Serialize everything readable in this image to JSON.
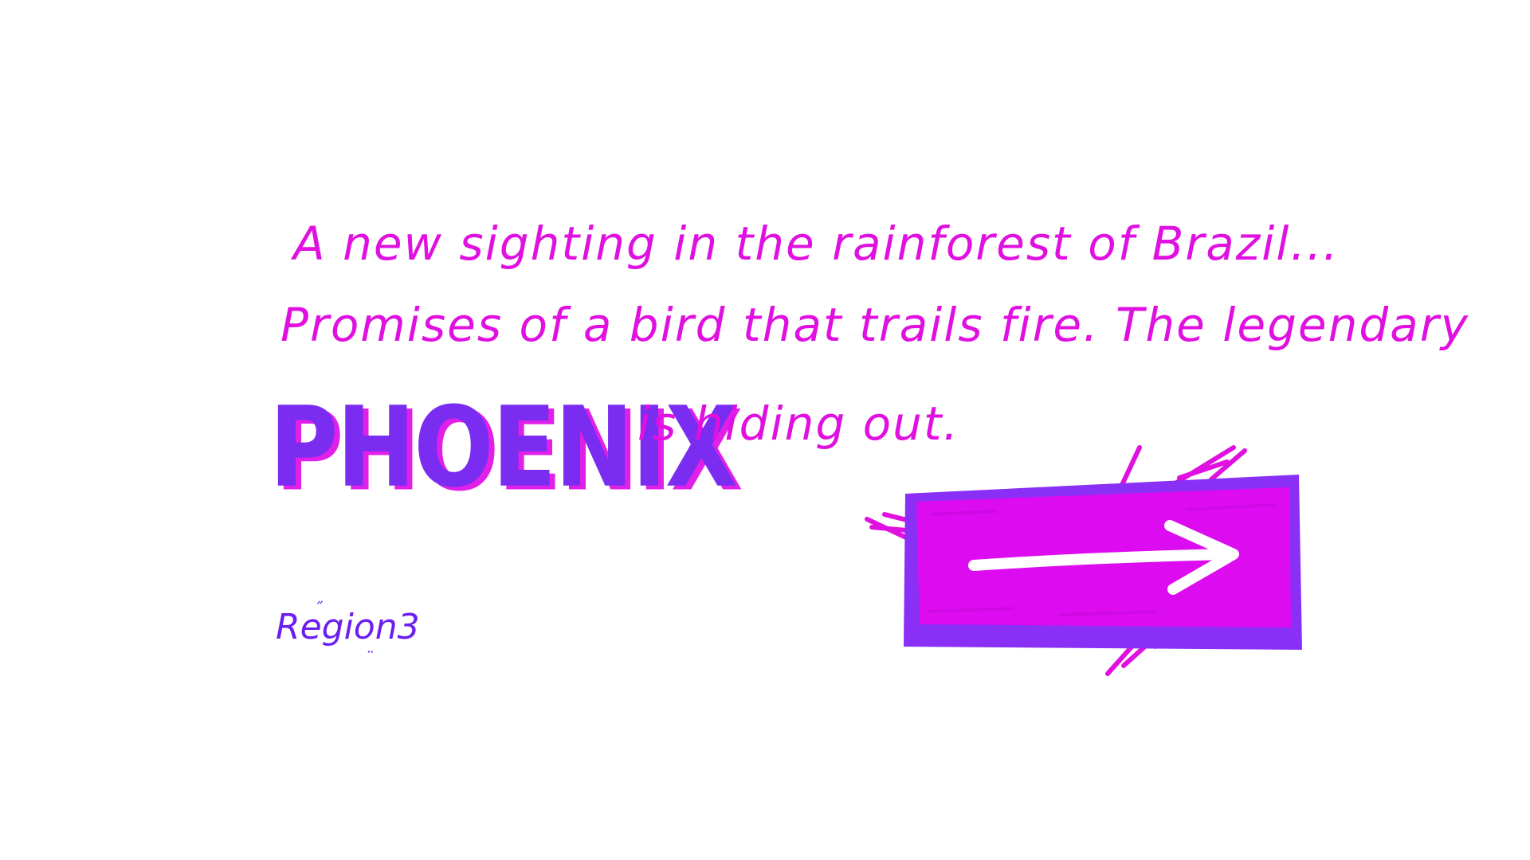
{
  "story": {
    "line1": "A new sighting  in the rainforest of Brazil...",
    "line2": "Promises of a bird that trails fire. The legendary",
    "phoenix": "PHOENIX",
    "line3": "is hiding out."
  },
  "logo": {
    "text": "Region3"
  },
  "next_button": {
    "icon": "right-arrow-icon"
  },
  "colors": {
    "background": "#ffffff",
    "text_magenta": "#e010e0",
    "phoenix_purple": "#7a2cf0",
    "phoenix_shadow": "#e020e8",
    "button_fill": "#dd0cf0",
    "button_frame": "#8a2ff5",
    "logo_purple": "#6a1ff0",
    "arrow_white": "#ffffff"
  }
}
